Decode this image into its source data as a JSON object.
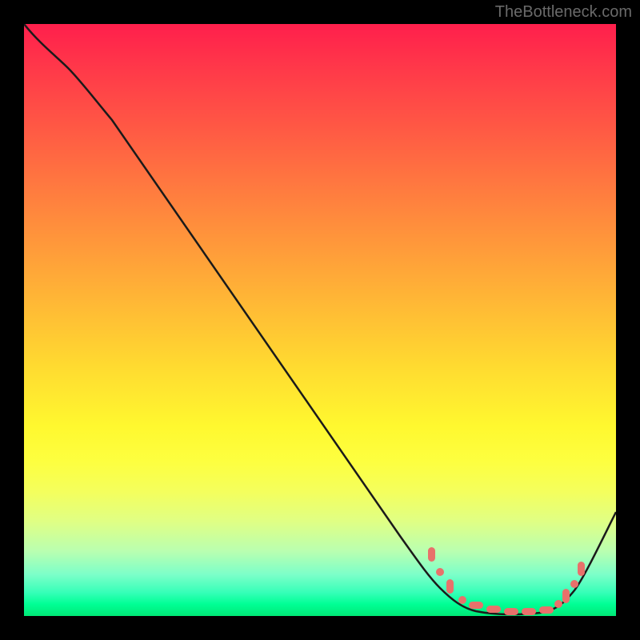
{
  "watermark": "TheBottleneck.com",
  "chart_data": {
    "type": "line",
    "title": "",
    "xlabel": "",
    "ylabel": "",
    "xlim": [
      0,
      100
    ],
    "ylim": [
      0,
      100
    ],
    "series": [
      {
        "name": "bottleneck-curve",
        "x": [
          0,
          5,
          10,
          20,
          30,
          40,
          50,
          60,
          68,
          72,
          76,
          80,
          84,
          88,
          92,
          100
        ],
        "y": [
          100,
          97,
          93,
          81,
          68,
          55,
          42,
          29,
          14,
          7,
          2,
          0,
          0,
          0,
          2,
          18
        ]
      }
    ],
    "markers": {
      "name": "optimal-range-markers",
      "points": [
        {
          "x": 69,
          "y": 11,
          "shape": "pill"
        },
        {
          "x": 70.5,
          "y": 8,
          "shape": "dot"
        },
        {
          "x": 72,
          "y": 5,
          "shape": "pill"
        },
        {
          "x": 74,
          "y": 2.5,
          "shape": "dot"
        },
        {
          "x": 76,
          "y": 1.5,
          "shape": "pill-h"
        },
        {
          "x": 78.5,
          "y": 1,
          "shape": "pill-h"
        },
        {
          "x": 81,
          "y": 0.5,
          "shape": "pill-h"
        },
        {
          "x": 83.5,
          "y": 0.5,
          "shape": "pill-h"
        },
        {
          "x": 86,
          "y": 0.5,
          "shape": "pill-h"
        },
        {
          "x": 88.5,
          "y": 1,
          "shape": "dot"
        },
        {
          "x": 90,
          "y": 2,
          "shape": "pill"
        },
        {
          "x": 91.5,
          "y": 5,
          "shape": "dot"
        },
        {
          "x": 93,
          "y": 8,
          "shape": "pill"
        }
      ]
    },
    "gradient": {
      "description": "vertical gradient from red (top, high bottleneck) to green (bottom, optimal)",
      "stops": [
        "#ff1f4c",
        "#ff7b3f",
        "#ffdb30",
        "#fdff40",
        "#7cffc9",
        "#00e876"
      ]
    }
  }
}
